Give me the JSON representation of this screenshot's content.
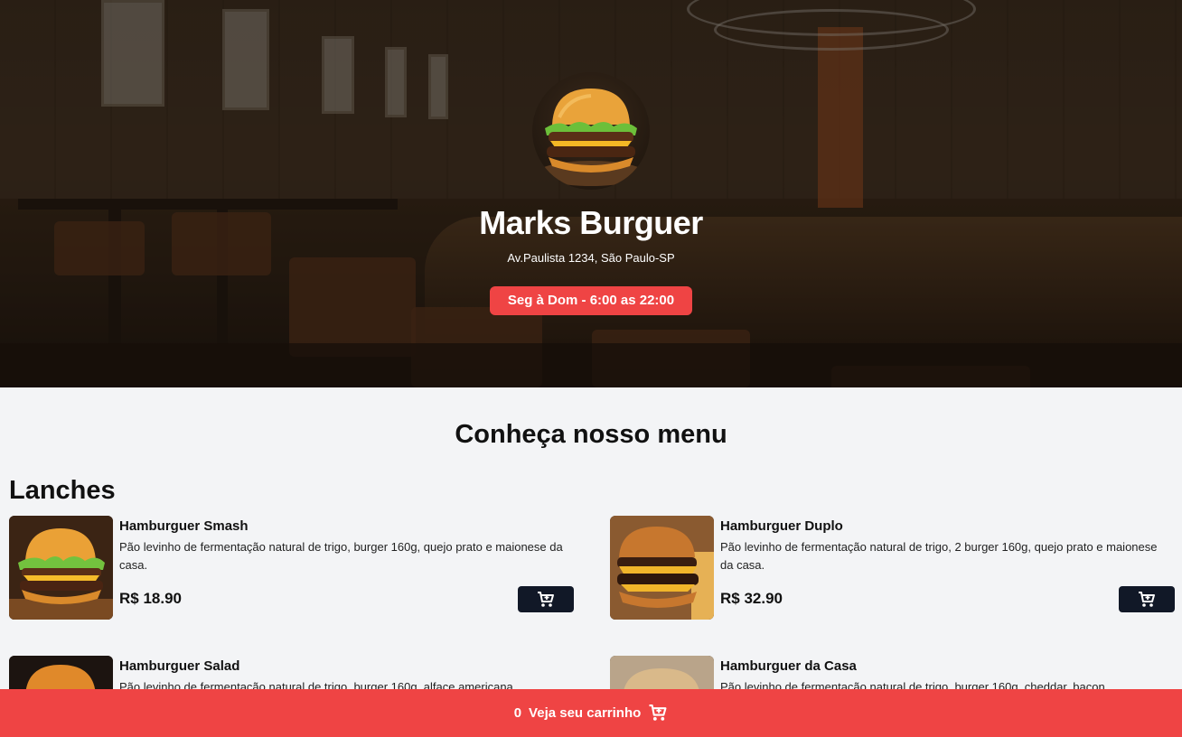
{
  "restaurant": {
    "name": "Marks Burguer",
    "address": "Av.Paulista 1234, São Paulo-SP",
    "hours": "Seg à Dom - 6:00 as 22:00"
  },
  "menu": {
    "heading": "Conheça nosso menu",
    "category": "Lanches",
    "items": [
      {
        "name": "Hamburguer Smash",
        "description": "Pão levinho de fermentação natural de trigo, burger 160g, quejo prato e maionese da casa.",
        "price": "R$ 18.90"
      },
      {
        "name": "Hamburguer Duplo",
        "description": "Pão levinho de fermentação natural de trigo, 2 burger 160g, quejo prato e maionese da casa.",
        "price": "R$ 32.90"
      },
      {
        "name": "Hamburguer Salad",
        "description": "Pão levinho de fermentação natural de trigo, burger 160g, alface americana"
      },
      {
        "name": "Hamburguer da Casa",
        "description": "Pão levinho de fermentação natural de trigo, burger 160g, cheddar, bacon"
      }
    ]
  },
  "cart": {
    "count": "0",
    "label": "Veja seu carrinho"
  },
  "colors": {
    "accent": "#ef4444",
    "button_dark": "#111827",
    "background": "#f3f4f6"
  },
  "icons": {
    "cart": "cart-plus-icon"
  }
}
